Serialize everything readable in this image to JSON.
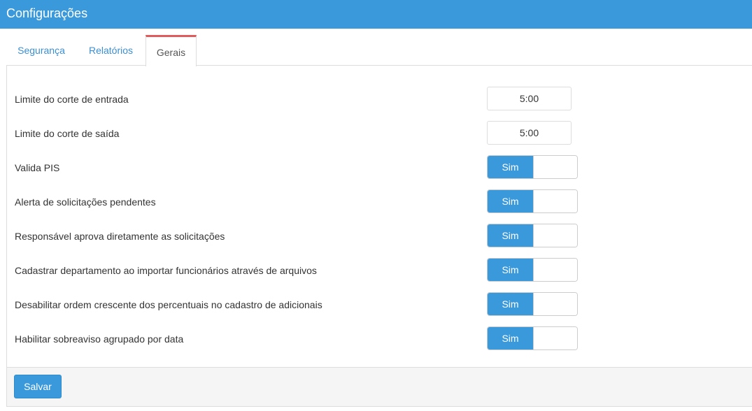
{
  "header": {
    "title": "Configurações"
  },
  "tabs": [
    {
      "label": "Segurança",
      "active": false
    },
    {
      "label": "Relatórios",
      "active": false
    },
    {
      "label": "Gerais",
      "active": true
    }
  ],
  "settings": {
    "entrada": {
      "label": "Limite do corte de entrada",
      "value": "5:00"
    },
    "saida": {
      "label": "Limite do corte de saída",
      "value": "5:00"
    },
    "toggles": [
      {
        "label": "Valida PIS",
        "state": "Sim"
      },
      {
        "label": "Alerta de solicitações pendentes",
        "state": "Sim"
      },
      {
        "label": "Responsável aprova diretamente as solicitações",
        "state": "Sim"
      },
      {
        "label": "Cadastrar departamento ao importar funcionários através de arquivos",
        "state": "Sim"
      },
      {
        "label": "Desabilitar ordem crescente dos percentuais no cadastro de adicionais",
        "state": "Sim"
      },
      {
        "label": "Habilitar sobreaviso agrupado por data",
        "state": "Sim"
      }
    ]
  },
  "footer": {
    "save_label": "Salvar"
  },
  "colors": {
    "primary": "#3a99db",
    "active_tab_border": "#e05c5c",
    "footer_bg": "#f5f5f5"
  }
}
